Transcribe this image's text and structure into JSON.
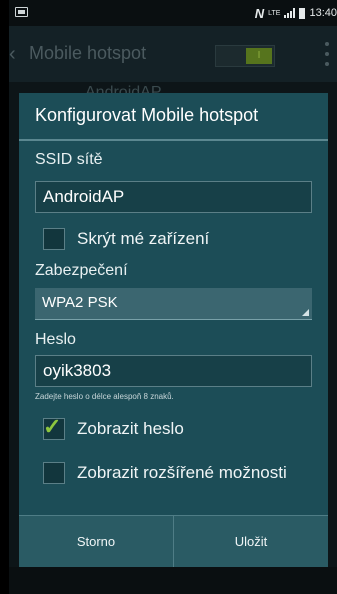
{
  "status_bar": {
    "nfc": "N",
    "network": "LTE",
    "time": "13:40"
  },
  "action_bar": {
    "title": "Mobile hotspot",
    "toggle_label": "I",
    "behind_text": "AndroidAP"
  },
  "dialog": {
    "title": "Konfigurovat Mobile hotspot",
    "ssid_label": "SSID sítě",
    "ssid_value": "AndroidAP",
    "hide_device_label": "Skrýt mé zařízení",
    "hide_device_checked": false,
    "security_label": "Zabezpečení",
    "security_value": "WPA2 PSK",
    "password_label": "Heslo",
    "password_value": "oyik3803",
    "password_hint": "Zadejte heslo o délce alespoň 8 znaků.",
    "show_password_label": "Zobrazit heslo",
    "show_password_checked": true,
    "advanced_label": "Zobrazit rozšířené možnosti",
    "advanced_checked": false,
    "cancel_label": "Storno",
    "save_label": "Uložit"
  },
  "colors": {
    "dialog_bg": "#1c4d57",
    "accent_check": "#8dc63f",
    "toggle_on": "#56741d"
  }
}
